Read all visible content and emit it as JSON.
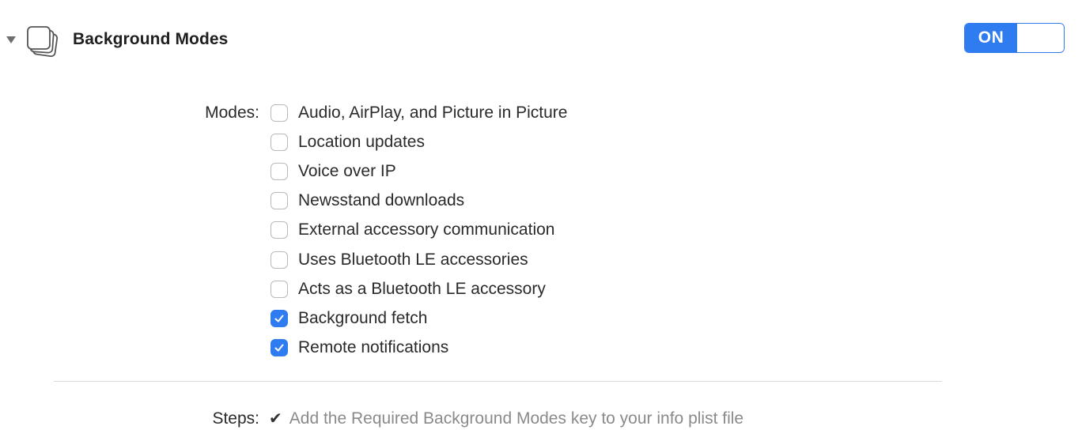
{
  "capability": {
    "title": "Background Modes",
    "icon": "stacked-windows-icon",
    "expanded": true,
    "toggle": {
      "label": "ON",
      "state": "on",
      "accent_color": "#2f7bf0"
    }
  },
  "modes": {
    "label": "Modes:",
    "items": [
      {
        "label": "Audio, AirPlay, and Picture in Picture",
        "checked": false
      },
      {
        "label": "Location updates",
        "checked": false
      },
      {
        "label": "Voice over IP",
        "checked": false
      },
      {
        "label": "Newsstand downloads",
        "checked": false
      },
      {
        "label": "External accessory communication",
        "checked": false
      },
      {
        "label": "Uses Bluetooth LE accessories",
        "checked": false
      },
      {
        "label": "Acts as a Bluetooth LE accessory",
        "checked": false
      },
      {
        "label": "Background fetch",
        "checked": true
      },
      {
        "label": "Remote notifications",
        "checked": true
      }
    ]
  },
  "steps": {
    "label": "Steps:",
    "items": [
      {
        "label": "Add the Required Background Modes key to your info plist file",
        "done": true,
        "icon": "checkmark-icon"
      }
    ]
  }
}
